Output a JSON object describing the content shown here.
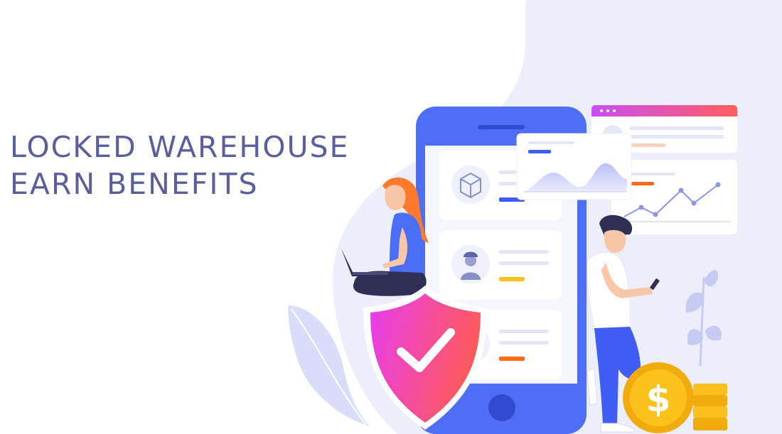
{
  "hero": {
    "headline_line1": "LOCKED WAREHOUSE",
    "headline_line2": "EARN BENEFITS"
  },
  "colors": {
    "headline": "#5a5f9c",
    "phone_primary": "#4f6ef7",
    "blob_background": "#eceefb",
    "shield_gradient_start": "#e63cf0",
    "shield_gradient_end": "#ff5a5a",
    "coin": "#fbbf1e",
    "accent_orange": "#ff6a1a",
    "accent_yellow": "#fbc21e"
  },
  "icons": {
    "checkmark": "check-icon",
    "dollar": "dollar-icon",
    "package": "package-icon",
    "worker": "worker-icon"
  }
}
